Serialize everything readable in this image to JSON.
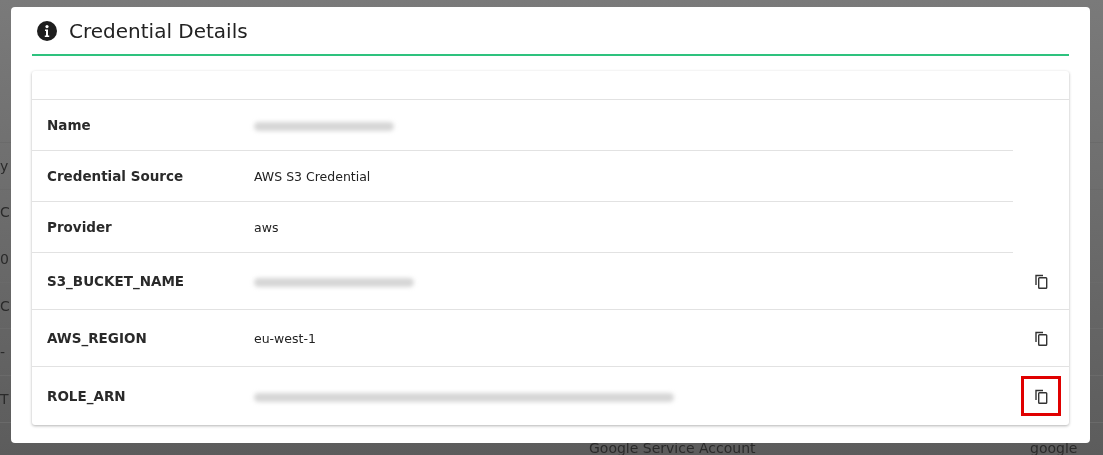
{
  "background_table": {
    "rows": [
      {
        "column_1": "y"
      },
      {
        "column_1": "C"
      },
      {
        "column_1": "0"
      },
      {
        "column_1": "C"
      },
      {
        "column_1": "-"
      },
      {
        "column_1": "T"
      },
      {
        "column_2": "Google Service Account",
        "column_3": "google"
      }
    ]
  },
  "dialog": {
    "title": "Credential Details",
    "rows": [
      {
        "label": "Name",
        "redacted": true,
        "copyable": false
      },
      {
        "label": "Credential Source",
        "value": "AWS S3 Credential",
        "redacted": false,
        "copyable": false
      },
      {
        "label": "Provider",
        "value": "aws",
        "redacted": false,
        "copyable": false
      },
      {
        "label": "S3_BUCKET_NAME",
        "redacted": true,
        "copyable": true,
        "highlighted": false
      },
      {
        "label": "AWS_REGION",
        "value": "eu-west-1",
        "redacted": false,
        "copyable": true,
        "highlighted": false
      },
      {
        "label": "ROLE_ARN",
        "redacted": true,
        "copyable": true,
        "highlighted": true
      }
    ]
  }
}
